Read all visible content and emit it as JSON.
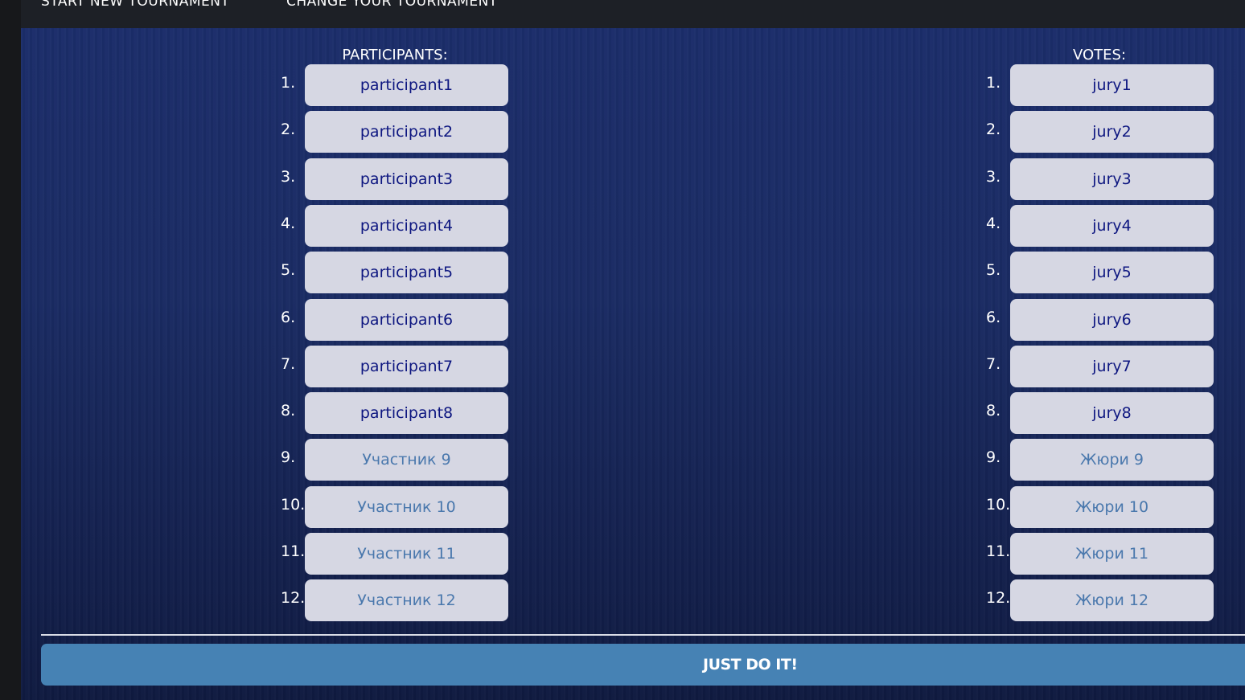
{
  "nav": {
    "start_label": "START NEW TOURNAMENT",
    "change_label": "CHANGE YOUR TOURNAMENT"
  },
  "participants": {
    "header": "PARTICIPANTS:",
    "rows": [
      {
        "num": "1.",
        "value": "participant1",
        "placeholder": ""
      },
      {
        "num": "2.",
        "value": "participant2",
        "placeholder": ""
      },
      {
        "num": "3.",
        "value": "participant3",
        "placeholder": ""
      },
      {
        "num": "4.",
        "value": "participant4",
        "placeholder": ""
      },
      {
        "num": "5.",
        "value": "participant5",
        "placeholder": ""
      },
      {
        "num": "6.",
        "value": "participant6",
        "placeholder": ""
      },
      {
        "num": "7.",
        "value": "participant7",
        "placeholder": ""
      },
      {
        "num": "8.",
        "value": "participant8",
        "placeholder": ""
      },
      {
        "num": "9.",
        "value": "",
        "placeholder": "Участник 9"
      },
      {
        "num": "10.",
        "value": "",
        "placeholder": "Участник 10"
      },
      {
        "num": "11.",
        "value": "",
        "placeholder": "Участник 11"
      },
      {
        "num": "12.",
        "value": "",
        "placeholder": "Участник 12"
      }
    ]
  },
  "votes": {
    "header": "VOTES:",
    "rows": [
      {
        "num": "1.",
        "value": "jury1",
        "placeholder": ""
      },
      {
        "num": "2.",
        "value": "jury2",
        "placeholder": ""
      },
      {
        "num": "3.",
        "value": "jury3",
        "placeholder": ""
      },
      {
        "num": "4.",
        "value": "jury4",
        "placeholder": ""
      },
      {
        "num": "5.",
        "value": "jury5",
        "placeholder": ""
      },
      {
        "num": "6.",
        "value": "jury6",
        "placeholder": ""
      },
      {
        "num": "7.",
        "value": "jury7",
        "placeholder": ""
      },
      {
        "num": "8.",
        "value": "jury8",
        "placeholder": ""
      },
      {
        "num": "9.",
        "value": "",
        "placeholder": "Жюри 9"
      },
      {
        "num": "10.",
        "value": "",
        "placeholder": "Жюри 10"
      },
      {
        "num": "11.",
        "value": "",
        "placeholder": "Жюри 11"
      },
      {
        "num": "12.",
        "value": "",
        "placeholder": "Жюри 12"
      }
    ]
  },
  "submit": {
    "label": "JUST DO IT!"
  },
  "colors": {
    "background": "#1a2b63",
    "field_bg": "#d6d7e3",
    "field_text": "#0d1680",
    "placeholder_text": "#4a78ad",
    "button_bg": "#4682b4",
    "topbar_bg": "#1d2026"
  }
}
